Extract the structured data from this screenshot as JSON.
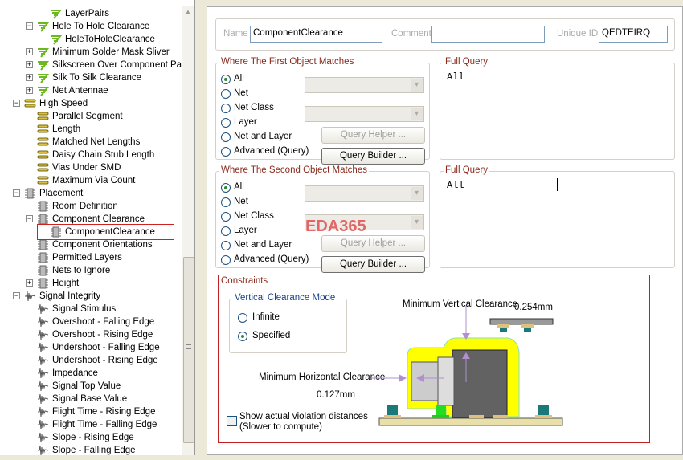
{
  "tree": [
    {
      "label": "LayerPairs",
      "level": 3,
      "exp": "",
      "icon": "drc"
    },
    {
      "label": "Hole To Hole Clearance",
      "level": 2,
      "exp": "-",
      "icon": "drc"
    },
    {
      "label": "HoleToHoleClearance",
      "level": 3,
      "exp": "",
      "icon": "drc"
    },
    {
      "label": "Minimum Solder Mask Sliver",
      "level": 2,
      "exp": "+",
      "icon": "drc"
    },
    {
      "label": "Silkscreen Over Component Pads",
      "level": 2,
      "exp": "+",
      "icon": "drc"
    },
    {
      "label": "Silk To Silk Clearance",
      "level": 2,
      "exp": "+",
      "icon": "drc"
    },
    {
      "label": "Net Antennae",
      "level": 2,
      "exp": "+",
      "icon": "drc"
    },
    {
      "label": "High Speed",
      "level": 1,
      "exp": "-",
      "icon": "hs"
    },
    {
      "label": "Parallel Segment",
      "level": 2,
      "exp": "",
      "icon": "hs"
    },
    {
      "label": "Length",
      "level": 2,
      "exp": "",
      "icon": "hs"
    },
    {
      "label": "Matched Net Lengths",
      "level": 2,
      "exp": "",
      "icon": "hs"
    },
    {
      "label": "Daisy Chain Stub Length",
      "level": 2,
      "exp": "",
      "icon": "hs"
    },
    {
      "label": "Vias Under SMD",
      "level": 2,
      "exp": "",
      "icon": "hs"
    },
    {
      "label": "Maximum Via Count",
      "level": 2,
      "exp": "",
      "icon": "hs"
    },
    {
      "label": "Placement",
      "level": 1,
      "exp": "-",
      "icon": "chip"
    },
    {
      "label": "Room Definition",
      "level": 2,
      "exp": "",
      "icon": "chip"
    },
    {
      "label": "Component Clearance",
      "level": 2,
      "exp": "-",
      "icon": "chip"
    },
    {
      "label": "ComponentClearance",
      "level": 3,
      "exp": "",
      "icon": "chip"
    },
    {
      "label": "Component Orientations",
      "level": 2,
      "exp": "",
      "icon": "chip"
    },
    {
      "label": "Permitted Layers",
      "level": 2,
      "exp": "",
      "icon": "chip"
    },
    {
      "label": "Nets to Ignore",
      "level": 2,
      "exp": "",
      "icon": "chip"
    },
    {
      "label": "Height",
      "level": 2,
      "exp": "+",
      "icon": "chip"
    },
    {
      "label": "Signal Integrity",
      "level": 1,
      "exp": "-",
      "icon": "wave"
    },
    {
      "label": "Signal Stimulus",
      "level": 2,
      "exp": "",
      "icon": "wave"
    },
    {
      "label": "Overshoot - Falling Edge",
      "level": 2,
      "exp": "",
      "icon": "wave"
    },
    {
      "label": "Overshoot - Rising Edge",
      "level": 2,
      "exp": "",
      "icon": "wave"
    },
    {
      "label": "Undershoot - Falling Edge",
      "level": 2,
      "exp": "",
      "icon": "wave"
    },
    {
      "label": "Undershoot - Rising Edge",
      "level": 2,
      "exp": "",
      "icon": "wave"
    },
    {
      "label": "Impedance",
      "level": 2,
      "exp": "",
      "icon": "wave"
    },
    {
      "label": "Signal Top Value",
      "level": 2,
      "exp": "",
      "icon": "wave"
    },
    {
      "label": "Signal Base Value",
      "level": 2,
      "exp": "",
      "icon": "wave"
    },
    {
      "label": "Flight Time - Rising Edge",
      "level": 2,
      "exp": "",
      "icon": "wave"
    },
    {
      "label": "Flight Time - Falling Edge",
      "level": 2,
      "exp": "",
      "icon": "wave"
    },
    {
      "label": "Slope - Rising Edge",
      "level": 2,
      "exp": "",
      "icon": "wave"
    },
    {
      "label": "Slope - Falling Edge",
      "level": 2,
      "exp": "",
      "icon": "wave"
    }
  ],
  "header": {
    "name_label": "Name",
    "name_value": "ComponentClearance",
    "comment_label": "Comment",
    "comment_value": "",
    "uid_label": "Unique ID",
    "uid_value": "QEDTEIRQ"
  },
  "first": {
    "title": "Where The First Object Matches",
    "options": [
      "All",
      "Net",
      "Net Class",
      "Layer",
      "Net and Layer",
      "Advanced (Query)"
    ],
    "selected": 0,
    "query_helper": "Query Helper ...",
    "query_builder": "Query Builder ...",
    "full_query_title": "Full Query",
    "full_query": "All"
  },
  "second": {
    "title": "Where The Second Object Matches",
    "options": [
      "All",
      "Net",
      "Net Class",
      "Layer",
      "Net and Layer",
      "Advanced (Query)"
    ],
    "selected": 0,
    "query_helper": "Query Helper ...",
    "query_builder": "Query Builder ...",
    "full_query_title": "Full Query",
    "full_query": "All"
  },
  "watermark": "EDA365",
  "constraints": {
    "title": "Constraints",
    "mode_title": "Vertical Clearance Mode",
    "modes": [
      "Infinite",
      "Specified"
    ],
    "selected_mode": 1,
    "vert_label": "Minimum Vertical Clearance",
    "vert_value": "0.254mm",
    "horiz_label": "Minimum Horizontal Clearance",
    "horiz_value": "0.127mm",
    "show_violations": "Show actual violation distances",
    "show_violations_sub": "(Slower to compute)"
  }
}
